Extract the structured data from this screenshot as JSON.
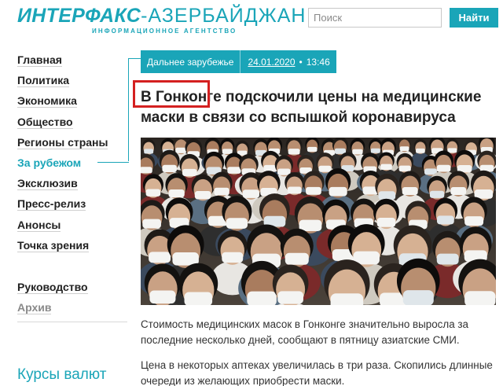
{
  "header": {
    "logo_main": "ИНТЕРФАКС",
    "logo_city": "-АЗЕРБАЙДЖАН",
    "logo_sub": "ИНФОРМАЦИОННОЕ АГЕНТСТВО",
    "search_placeholder": "Поиск",
    "search_button": "Найти"
  },
  "nav": {
    "items": [
      {
        "label": "Главная"
      },
      {
        "label": "Политика"
      },
      {
        "label": "Экономика"
      },
      {
        "label": "Общество"
      },
      {
        "label": "Регионы страны"
      },
      {
        "label": "За рубежом"
      },
      {
        "label": "Эксклюзив"
      },
      {
        "label": "Пресс-релиз"
      },
      {
        "label": "Анонсы"
      },
      {
        "label": "Точка зрения"
      }
    ],
    "secondary": [
      {
        "label": "Руководство"
      },
      {
        "label": "Архив"
      }
    ],
    "rates_title": "Курсы валют"
  },
  "article": {
    "category": "Дальнее зарубежье",
    "date": "24.01.2020",
    "dot": "•",
    "time": "13:46",
    "headline_highlight": "В Гонконге",
    "headline_rest": " подскочили цены на медицинские маски в связи со вспышкой коронавируса",
    "lead": "Стоимость медицинских масок в Гонконге значительно выросла за последние несколько дней, сообщают в пятницу азиатские СМИ.",
    "paragraph2": "Цена в некоторых аптеках увеличилась в три раза. Скопились длинные очереди из желающих приобрести маски."
  },
  "colors": {
    "accent": "#1aa5b8",
    "highlight": "#d42020"
  }
}
